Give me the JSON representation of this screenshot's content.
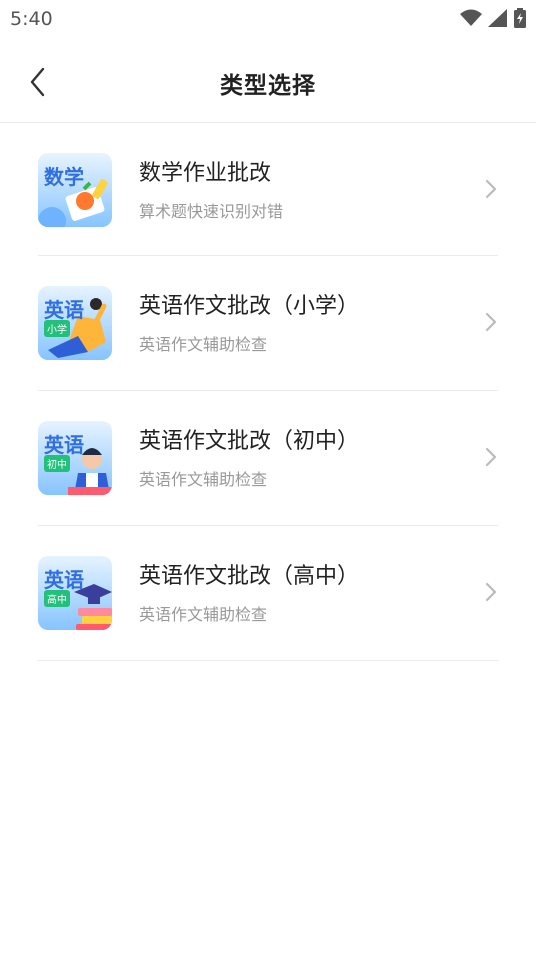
{
  "status": {
    "time": "5:40"
  },
  "header": {
    "title": "类型选择"
  },
  "items": [
    {
      "title": "数学作业批改",
      "subtitle": "算术题快速识别对错",
      "badge": "数学",
      "tag": ""
    },
    {
      "title": "英语作文批改（小学）",
      "subtitle": "英语作文辅助检查",
      "badge": "英语",
      "tag": "小学"
    },
    {
      "title": "英语作文批改（初中）",
      "subtitle": "英语作文辅助检查",
      "badge": "英语",
      "tag": "初中"
    },
    {
      "title": "英语作文批改（高中）",
      "subtitle": "英语作文辅助检查",
      "badge": "英语",
      "tag": "高中"
    }
  ],
  "colors": {
    "badge_text": "#2f6fe0",
    "tag_bg": "#22c07a",
    "thumb_bg_top": "#e6f3ff",
    "thumb_bg_bottom": "#8fc9ff"
  }
}
